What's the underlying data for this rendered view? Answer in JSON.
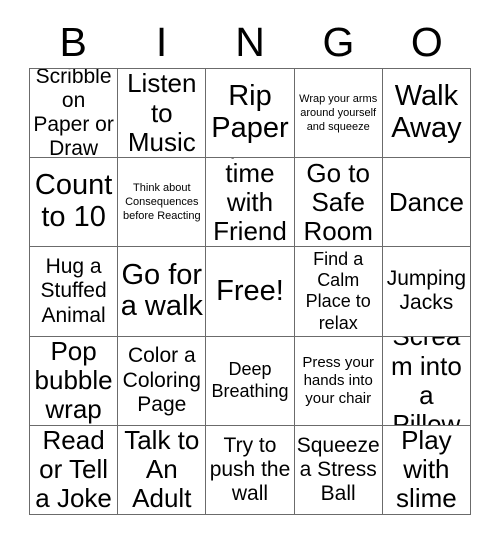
{
  "card": {
    "type": "bingo-card",
    "header_letters": [
      "B",
      "I",
      "N",
      "G",
      "O"
    ],
    "columns": 5,
    "rows": 5,
    "colors": {
      "background": "#ffffff",
      "text": "#000000",
      "grid_line": "#6b6b6b"
    },
    "cells": [
      {
        "text": "Scribble on Paper or Draw",
        "size": "lg"
      },
      {
        "text": "Listen to Music",
        "size": "xl"
      },
      {
        "text": "Rip Paper",
        "size": "xxl"
      },
      {
        "text": "Wrap your arms around yourself and squeeze",
        "size": "xs"
      },
      {
        "text": "Walk Away",
        "size": "xxl"
      },
      {
        "text": "Count to 10",
        "size": "xxl"
      },
      {
        "text": "Think about Consequences before Reacting",
        "size": "xs"
      },
      {
        "text": "Spend time with Friends",
        "size": "xl"
      },
      {
        "text": "Go to Safe Room",
        "size": "xl"
      },
      {
        "text": "Dance",
        "size": "xl"
      },
      {
        "text": "Hug a Stuffed Animal",
        "size": "lg"
      },
      {
        "text": "Go for a walk",
        "size": "xxl"
      },
      {
        "text": "Free!",
        "size": "xxl"
      },
      {
        "text": "Find a Calm Place to relax",
        "size": "md"
      },
      {
        "text": "Jumping Jacks",
        "size": "lg"
      },
      {
        "text": "Pop bubble wrap",
        "size": "xl"
      },
      {
        "text": "Color a Coloring Page",
        "size": "lg"
      },
      {
        "text": "Deep Breathing",
        "size": "md"
      },
      {
        "text": "Press your hands into your chair",
        "size": "sm"
      },
      {
        "text": "Scream into a Pillow",
        "size": "xl"
      },
      {
        "text": "Read or Tell a Joke",
        "size": "xl"
      },
      {
        "text": "Talk to An Adult",
        "size": "xl"
      },
      {
        "text": "Try to push the wall",
        "size": "lg"
      },
      {
        "text": "Squeeze a Stress Ball",
        "size": "lg"
      },
      {
        "text": "Play with slime",
        "size": "xl"
      }
    ]
  }
}
